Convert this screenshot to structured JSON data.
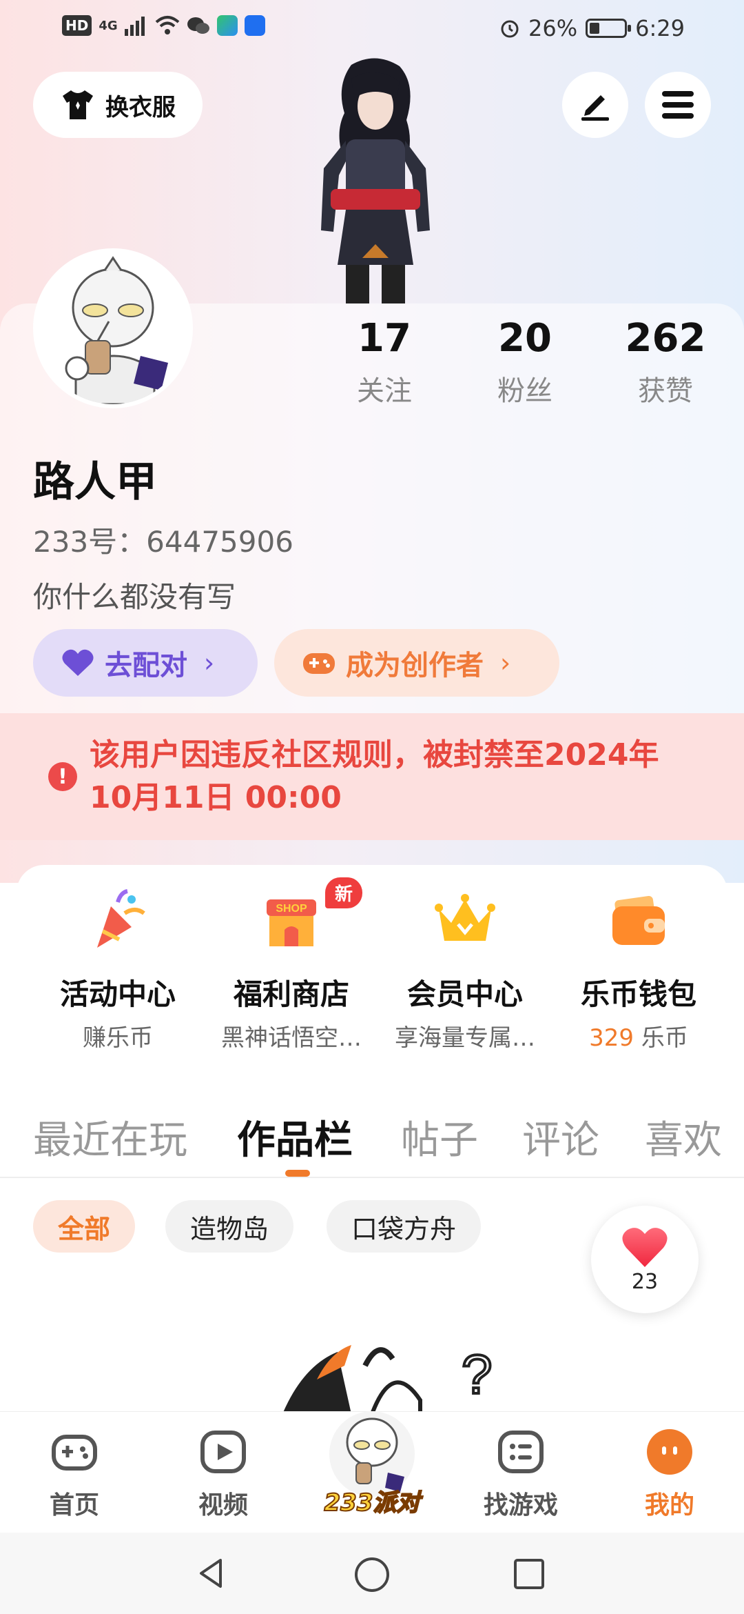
{
  "status_bar": {
    "hd": "HD",
    "signal": "4G",
    "battery": "26%",
    "time": "6:29"
  },
  "header": {
    "outfit_label": "换衣服"
  },
  "profile": {
    "stats": [
      {
        "num": "17",
        "label": "关注"
      },
      {
        "num": "20",
        "label": "粉丝"
      },
      {
        "num": "262",
        "label": "获赞"
      }
    ],
    "username": "路人甲",
    "uid": "233号：64475906",
    "bio": "你什么都没有写",
    "match_label": "去配对",
    "creator_label": "成为创作者"
  },
  "ban": {
    "line1": "该用户因违反社区规则，被封禁至2024年",
    "line2": "10月11日 00:00"
  },
  "features": [
    {
      "title": "活动中心",
      "sub": "赚乐币"
    },
    {
      "title": "福利商店",
      "sub": "黑神话悟空…",
      "badge": "新"
    },
    {
      "title": "会员中心",
      "sub": "享海量专属…"
    },
    {
      "title": "乐币钱包",
      "coin": "329",
      "sub": " 乐币"
    }
  ],
  "tabs": [
    "最近在玩",
    "作品栏",
    "帖子",
    "评论",
    "喜欢"
  ],
  "chips": [
    "全部",
    "造物岛",
    "口袋方舟"
  ],
  "like_count": "23",
  "nav": {
    "home": "首页",
    "video": "视频",
    "party": "233派对",
    "find": "找游戏",
    "mine": "我的"
  },
  "colors": {
    "accent": "#f07a2a",
    "ban_red": "#e8473f",
    "match_purple": "#6d4fd6"
  }
}
